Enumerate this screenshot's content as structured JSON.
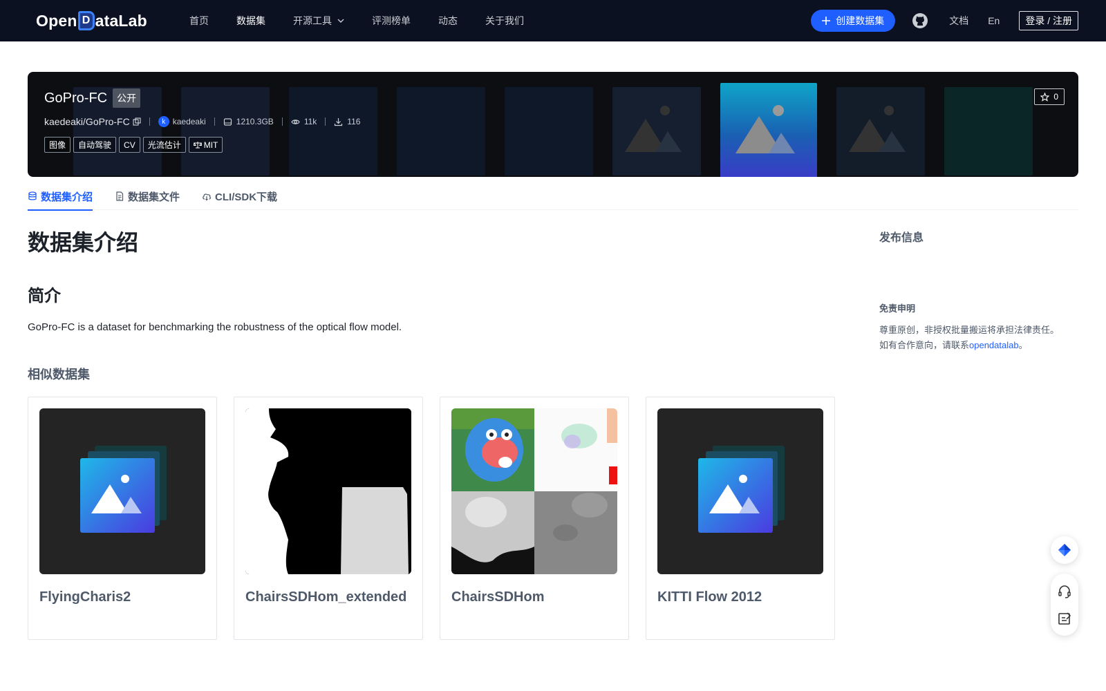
{
  "nav": {
    "logo_pre": "Open",
    "logo_d": "D",
    "logo_post": "ataLab",
    "items": [
      "首页",
      "数据集",
      "开源工具",
      "评测榜单",
      "动态",
      "关于我们"
    ],
    "active_index": 1,
    "create_label": "创建数据集",
    "docs": "文档",
    "lang": "En",
    "login": "登录 / 注册"
  },
  "dataset": {
    "name": "GoPro-FC",
    "visibility": "公开",
    "repo": "kaedeaki/GoPro-FC",
    "avatar_letter": "k",
    "user": "kaedeaki",
    "size": "1210.3GB",
    "views": "11k",
    "downloads": "116",
    "tags": [
      "图像",
      "自动驾驶",
      "CV",
      "光流估计"
    ],
    "license": "MIT",
    "stars": "0"
  },
  "tabs": [
    "数据集介绍",
    "数据集文件",
    "CLI/SDK下载"
  ],
  "main": {
    "heading": "数据集介绍",
    "section_title": "简介",
    "description": "GoPro-FC is a dataset for benchmarking the robustness of the optical flow model.",
    "similar_title": "相似数据集",
    "similar": [
      {
        "title": "FlyingCharis2",
        "image": "placeholder-image-icon"
      },
      {
        "title": "ChairsSDHom_extended",
        "image": "silhouette-mask"
      },
      {
        "title": "ChairsSDHom",
        "image": "chairs-grid"
      },
      {
        "title": "KITTI Flow 2012",
        "image": "placeholder-image-icon"
      }
    ]
  },
  "sidebar": {
    "publish_info": "发布信息",
    "disclaimer_title": "免责申明",
    "disclaimer_line1": "尊重原创，非授权批量搬运将承担法律责任。",
    "disclaimer_line2_pre": "如有合作意向，请联系",
    "disclaimer_link": "opendatalab",
    "disclaimer_line2_post": "。"
  },
  "colors": {
    "nav_bg": "#0c1121",
    "accent": "#1f5fff",
    "banner_bg": "#0d0e12"
  }
}
